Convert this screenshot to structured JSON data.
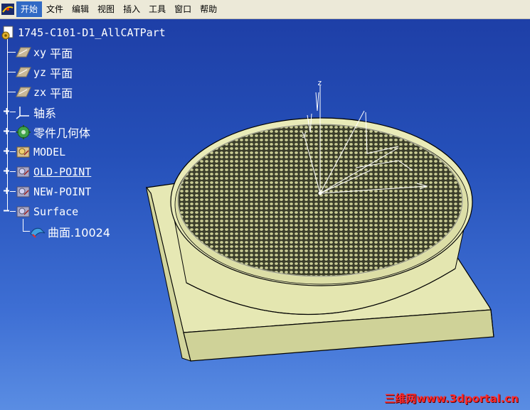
{
  "menu": {
    "items": [
      {
        "label": "开始",
        "active": true
      },
      {
        "label": "文件"
      },
      {
        "label": "编辑"
      },
      {
        "label": "视图"
      },
      {
        "label": "插入"
      },
      {
        "label": "工具"
      },
      {
        "label": "窗口"
      },
      {
        "label": "帮助"
      }
    ]
  },
  "tree": {
    "root": {
      "label": "1745-C101-D1_AllCATPart",
      "icon": "part-gear-icon"
    },
    "planes": [
      {
        "label_prefix": "xy",
        "label_suffix": "平面",
        "icon": "plane-icon"
      },
      {
        "label_prefix": "yz",
        "label_suffix": "平面",
        "icon": "plane-icon"
      },
      {
        "label_prefix": "zx",
        "label_suffix": "平面",
        "icon": "plane-icon"
      }
    ],
    "axis_system": {
      "label": "轴系",
      "icon": "axis-system-icon"
    },
    "part_body": {
      "label": "零件几何体",
      "icon": "part-body-gear-icon"
    },
    "model": {
      "label": "MODEL",
      "icon": "geometrical-set-icon"
    },
    "old_point": {
      "label": "OLD-POINT",
      "icon": "geometrical-set-icon"
    },
    "new_point": {
      "label": "NEW-POINT",
      "icon": "geometrical-set-icon"
    },
    "surface": {
      "label": "Surface",
      "icon": "geometrical-set-icon"
    },
    "surface_child": {
      "label": "曲面.10024",
      "icon": "surface-icon"
    }
  },
  "viewport": {
    "axis_labels": {
      "z": "z",
      "y": "y"
    },
    "colors": {
      "part": "#e5e7b0",
      "part_shadow": "#b9bc82",
      "edge": "#000000",
      "bg_top": "#1e3fa7",
      "bg_bottom": "#5a8de3"
    }
  },
  "watermark": "三维网www.3dportal.cn"
}
